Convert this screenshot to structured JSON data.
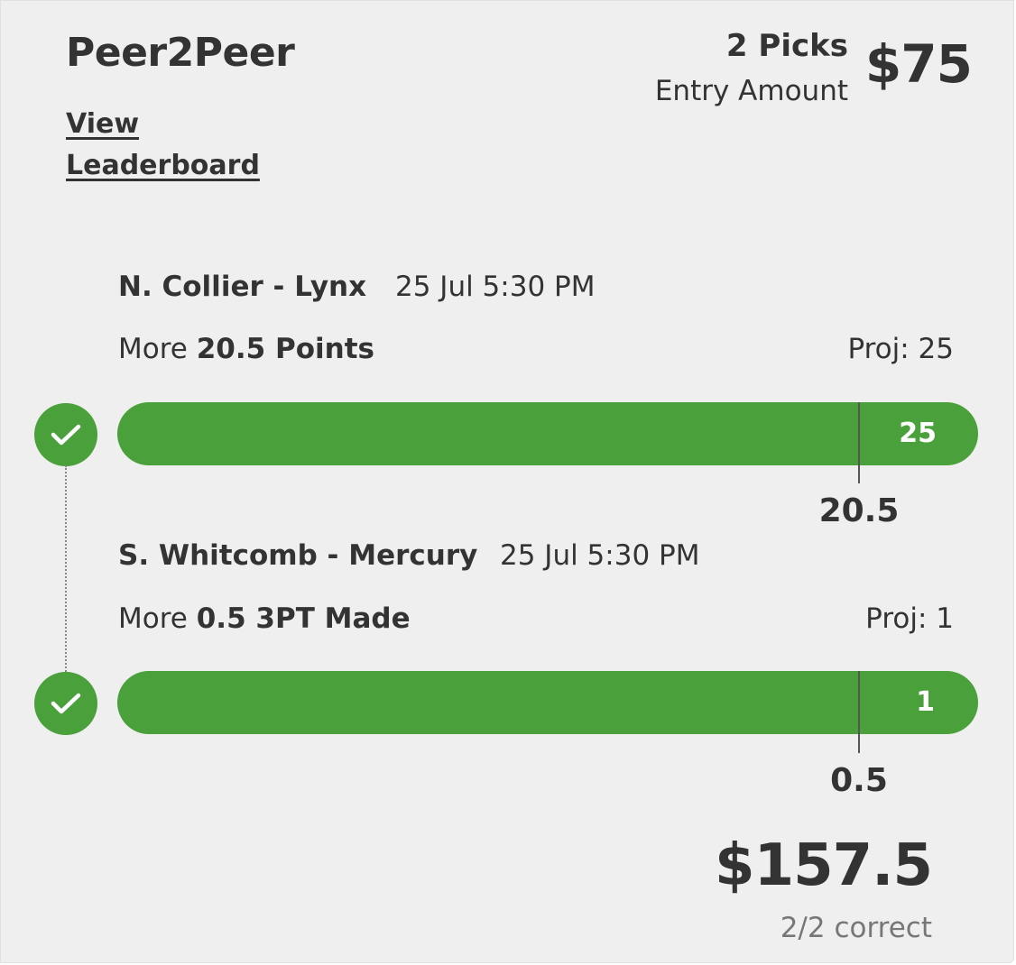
{
  "contest": {
    "title": "Peer2Peer",
    "leaderboard_link": "View Leaderboard",
    "picks_count": "2 Picks",
    "entry_label": "Entry Amount",
    "entry_amount": "$75"
  },
  "picks": [
    {
      "player": "N. Collier - Lynx",
      "time": "25 Jul 5:30 PM",
      "direction": "More",
      "line": "20.5 Points",
      "proj": "Proj: 25",
      "bar_value": "25",
      "marker_value": "20.5",
      "status": "correct"
    },
    {
      "player": "S. Whitcomb - Mercury",
      "time": "25 Jul 5:30 PM",
      "direction": "More",
      "line": "0.5 3PT Made",
      "proj": "Proj: 1",
      "bar_value": "1",
      "marker_value": "0.5",
      "status": "correct"
    }
  ],
  "result": {
    "payout": "$157.5",
    "correct_text": "2/2 correct"
  },
  "colors": {
    "accent_green": "#4aa03a",
    "background": "#efefef",
    "text": "#333333",
    "muted_text": "#777777"
  },
  "icons": {
    "status": "check-icon"
  }
}
